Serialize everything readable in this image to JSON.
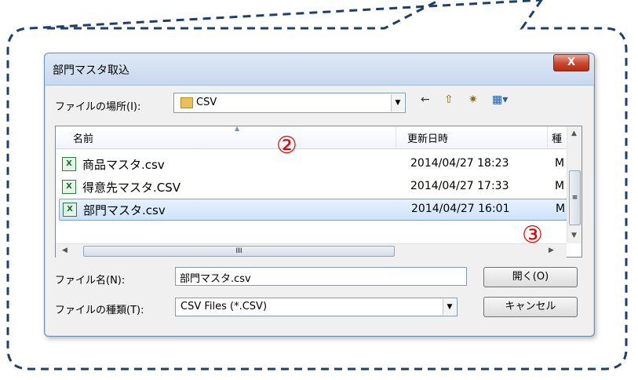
{
  "dialog": {
    "title": "部門マスタ取込",
    "close_label": "X",
    "location_label": "ファイルの場所(I):",
    "location_value": "CSV",
    "toolbar": {
      "back": "←",
      "up": "⇧",
      "new_folder": "✷",
      "view": "▦▾"
    },
    "columns": [
      "名前",
      "更新日時",
      "種"
    ],
    "files": [
      {
        "name": "商品マスタ.csv",
        "date": "2014/04/27 18:23",
        "type": "M"
      },
      {
        "name": "得意先マスタ.CSV",
        "date": "2014/04/27 17:33",
        "type": "M"
      },
      {
        "name": "部門マスタ.csv",
        "date": "2014/04/27 16:01",
        "type": "M",
        "selected": true
      }
    ],
    "filename_label": "ファイル名(N):",
    "filename_value": "部門マスタ.csv",
    "filetype_label": "ファイルの種類(T):",
    "filetype_value": "CSV Files (*.CSV)",
    "open_button": "開く(O)",
    "cancel_button": "キャンセル"
  },
  "annotations": {
    "marker2": "②",
    "marker3": "③"
  },
  "colors": {
    "annotation": "#e00000",
    "bubble_border": "#1f3f6b",
    "selection": "#cfe3fb"
  }
}
